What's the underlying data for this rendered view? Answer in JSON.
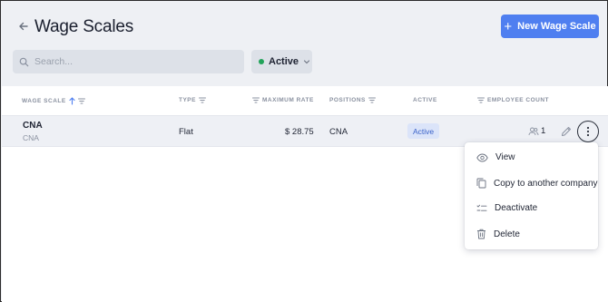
{
  "header": {
    "title": "Wage Scales",
    "new_button_label": "New Wage Scale"
  },
  "search": {
    "placeholder": "Search..."
  },
  "filter": {
    "label": "Active",
    "status_color": "#22a35a"
  },
  "table": {
    "columns": {
      "wage_scale": "WAGE SCALE",
      "type": "TYPE",
      "max_rate": "MAXIMUM RATE",
      "positions": "POSITIONS",
      "active": "ACTIVE",
      "employee_count": "EMPLOYEE COUNT"
    },
    "rows": [
      {
        "name": "CNA",
        "code": "CNA",
        "type": "Flat",
        "max_rate": "$ 28.75",
        "positions": "CNA",
        "active": "Active",
        "employee_count": "1"
      }
    ]
  },
  "menu": {
    "items": [
      "View",
      "Copy to another company",
      "Deactivate",
      "Delete"
    ]
  },
  "colors": {
    "accent": "#4f7ff0",
    "badge_bg": "#dbe4f9",
    "badge_text": "#3b63c9"
  }
}
